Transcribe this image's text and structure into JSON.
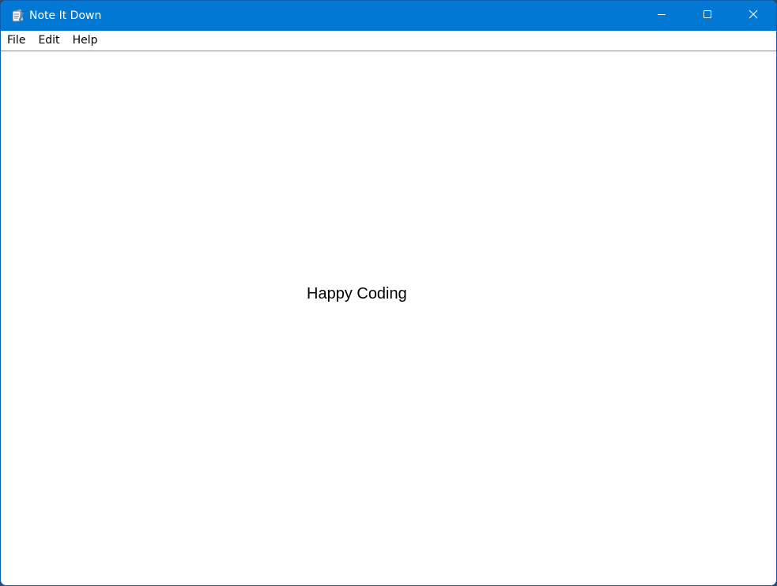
{
  "window": {
    "title": "Note It Down",
    "accent_color": "#0078d4",
    "app_icon": "notepad-icon",
    "caption_buttons": [
      {
        "name": "minimize",
        "icon": "minimize-icon"
      },
      {
        "name": "maximize",
        "icon": "maximize-icon"
      },
      {
        "name": "close",
        "icon": "close-icon"
      }
    ]
  },
  "menubar": {
    "items": [
      {
        "label": "File"
      },
      {
        "label": "Edit"
      },
      {
        "label": "Help"
      }
    ]
  },
  "editor": {
    "content": "Happy Coding"
  }
}
